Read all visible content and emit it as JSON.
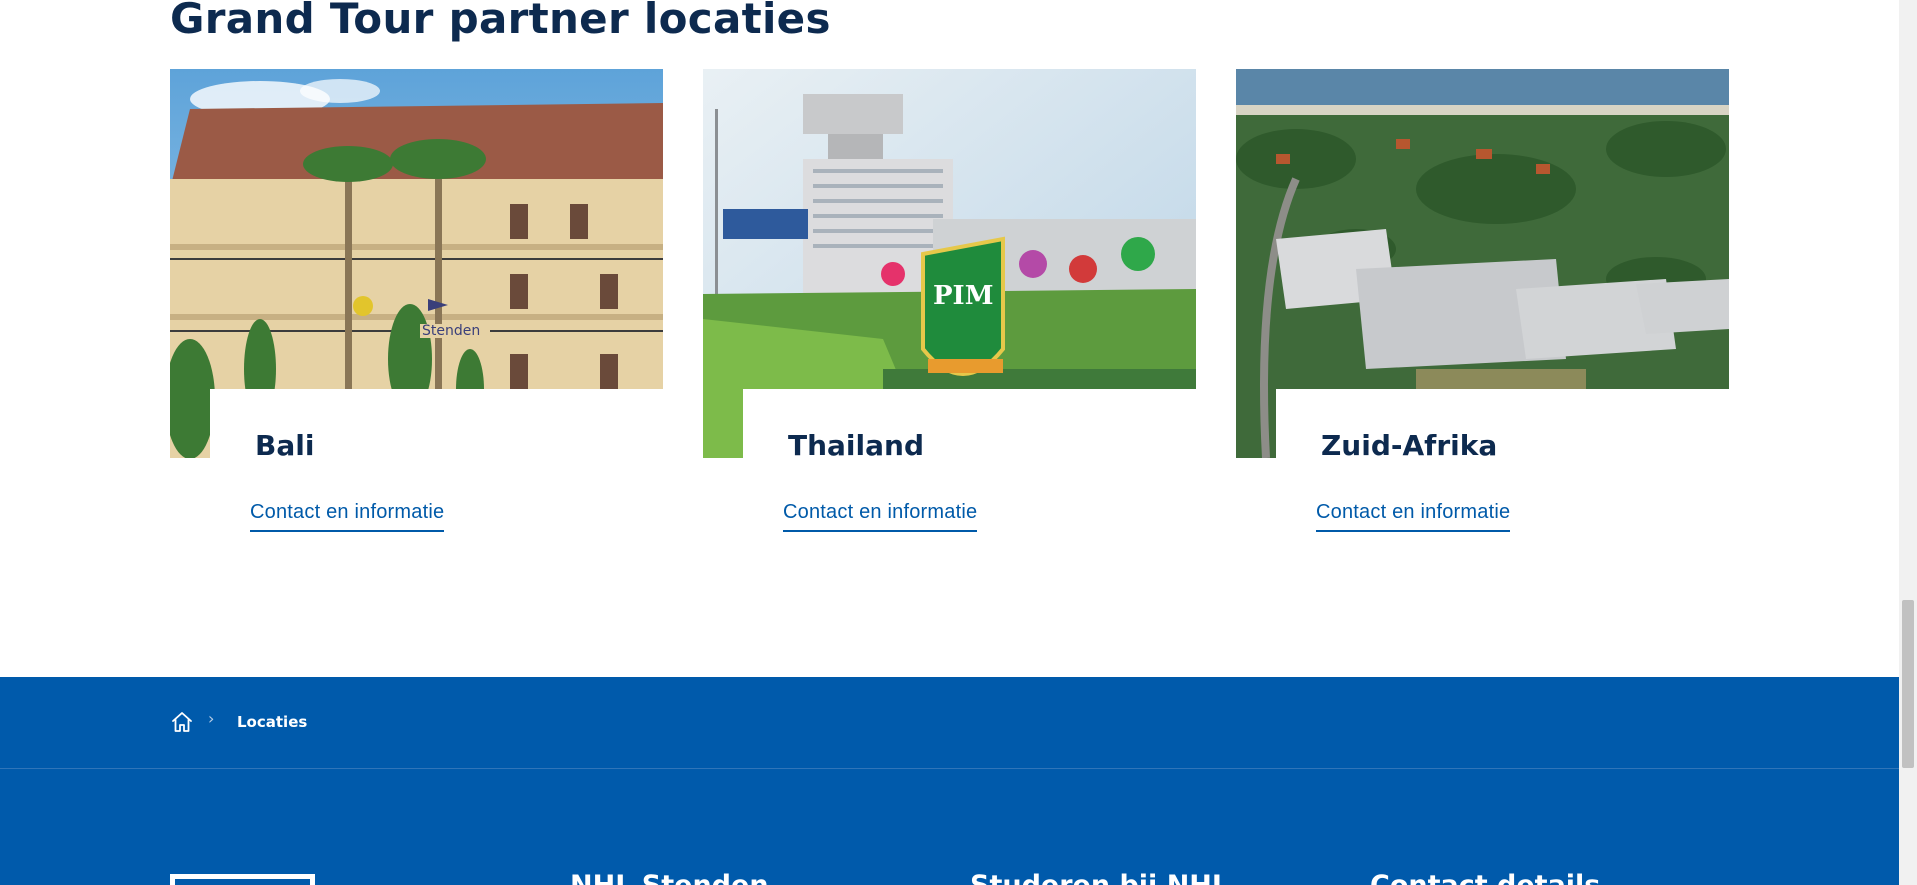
{
  "section": {
    "title": "Grand Tour partner locaties"
  },
  "cards": [
    {
      "title": "Bali",
      "link": "Contact en informatie",
      "image": "bali-campus-photo"
    },
    {
      "title": "Thailand",
      "link": "Contact en informatie",
      "image": "thailand-campus-photo"
    },
    {
      "title": "Zuid-Afrika",
      "link": "Contact en informatie",
      "image": "zuid-afrika-campus-photo"
    }
  ],
  "breadcrumb": {
    "home_icon": "home-icon",
    "separator": "›",
    "current": "Locaties"
  },
  "footer": {
    "headings": [
      "NHL Stenden",
      "Studeren bij NHL",
      "Contact details"
    ]
  },
  "colors": {
    "primary_blue": "#005aab",
    "title_navy": "#0d2a4f",
    "link_blue": "#005aa9"
  }
}
